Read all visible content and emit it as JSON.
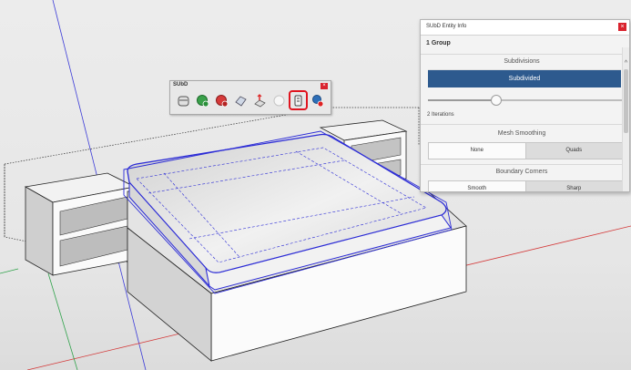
{
  "toolbar": {
    "title": "SUbD",
    "close_glyph": "×",
    "tools": [
      {
        "icon": "toggle-subd-icon",
        "active": false
      },
      {
        "icon": "crease-add-icon",
        "active": false
      },
      {
        "icon": "crease-remove-icon",
        "active": false
      },
      {
        "icon": "smooth-edges-icon",
        "active": false
      },
      {
        "icon": "vertex-move-icon",
        "active": false
      },
      {
        "icon": "sphere-icon",
        "active": false
      },
      {
        "icon": "entity-info-icon",
        "active": true
      },
      {
        "icon": "settings-icon",
        "active": false
      }
    ]
  },
  "panel": {
    "title": "SUbD Entity Info",
    "close_glyph": "×",
    "selection": "1 Group",
    "subdivisions": {
      "heading": "Subdivisions",
      "button_label": "Subdivided",
      "iterations_label": "2 Iterations",
      "slider_fraction": 0.35
    },
    "mesh_smoothing": {
      "heading": "Mesh Smoothing",
      "options": [
        "None",
        "Quads"
      ],
      "selected": "Quads"
    },
    "boundary_corners": {
      "heading": "Boundary Corners",
      "options": [
        "Smooth",
        "Sharp"
      ],
      "selected": "Sharp"
    }
  },
  "colors": {
    "selection_blue": "#2b2bd6",
    "primary_button": "#2d5a8e",
    "active_tool_outline": "#e0151f",
    "close_red": "#d9232e"
  }
}
